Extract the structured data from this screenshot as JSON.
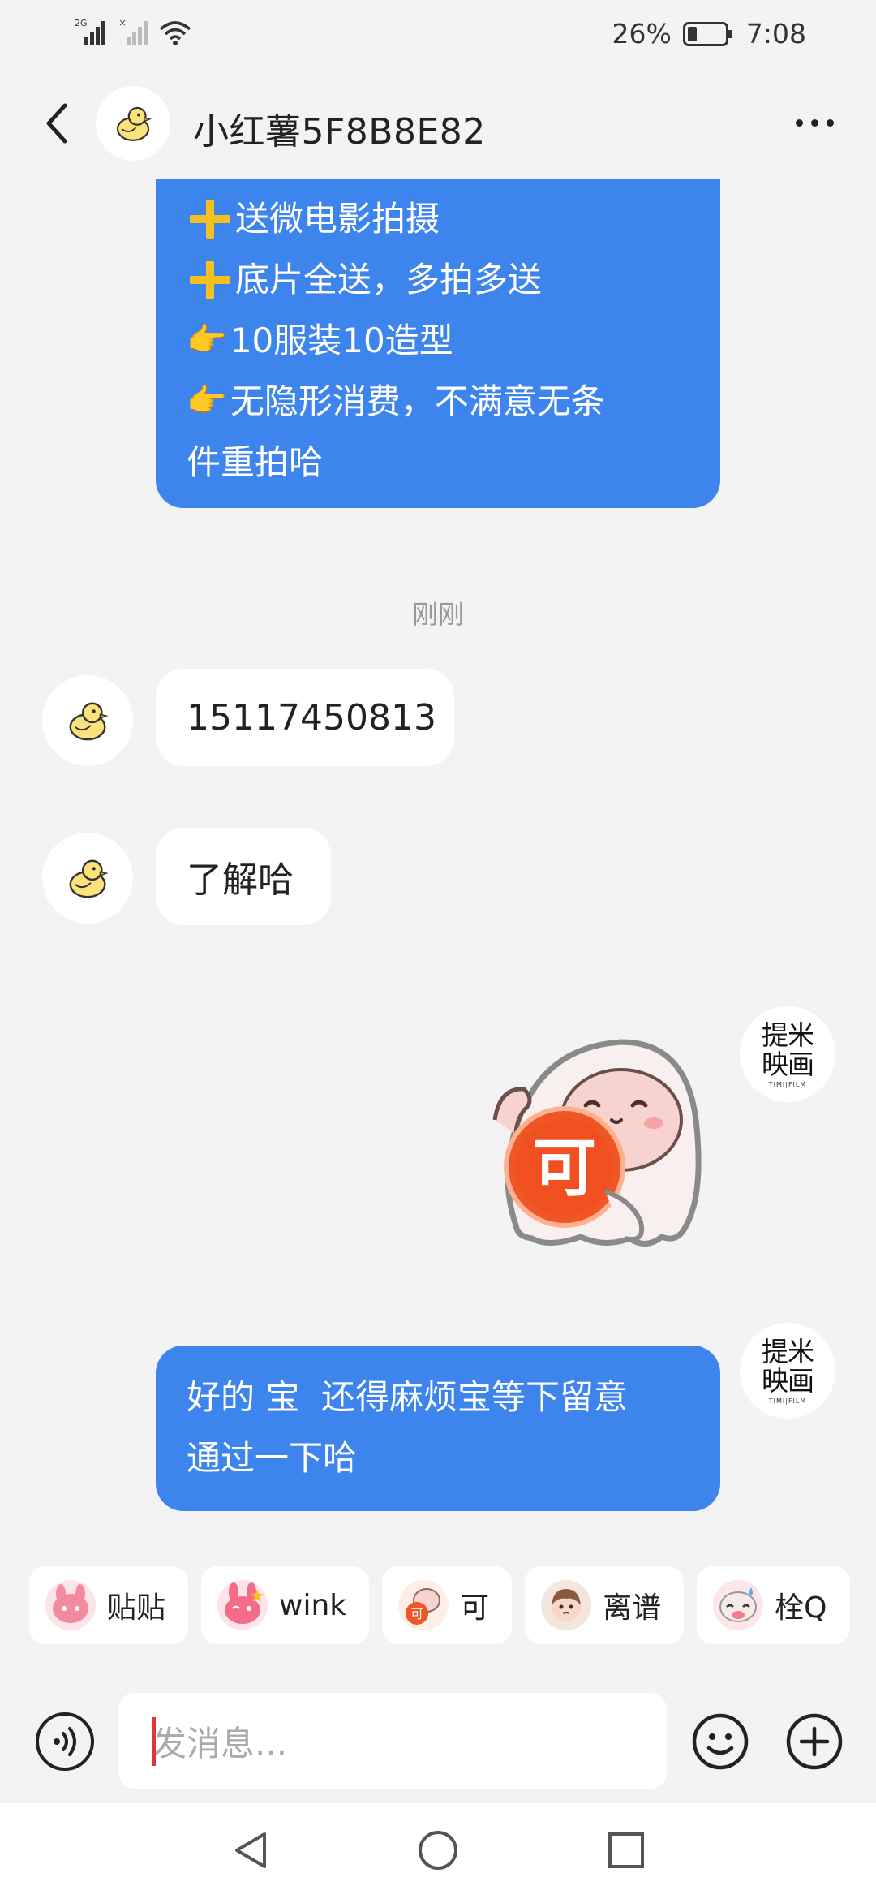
{
  "status_bar": {
    "network_label": "2G",
    "battery": "26%",
    "battery_level": 0.26,
    "time": "7:08"
  },
  "header": {
    "title": "小红薯5F8B8E82",
    "back_icon": "chevron-left-icon",
    "more_icon": "more-horizontal-icon"
  },
  "messages": {
    "top_bubble_lines": [
      "送微电影拍摄",
      "底片全送，多拍多送",
      "10服装10造型",
      "无隐形消费，不满意无条",
      "件重拍哈"
    ],
    "timestamp": "刚刚",
    "phone": "15117450813",
    "reply": "了解哈",
    "sticker_text": "可",
    "last_lines": [
      "好的 宝  还得麻烦宝等下留意",
      "通过一下哈"
    ]
  },
  "avatars": {
    "self_logo_line1": "提米",
    "self_logo_line2": "映画",
    "self_logo_sub": "TIMI|FILM"
  },
  "quick_replies": [
    {
      "label": "贴贴",
      "icon": "pink-bunny-sticker-icon",
      "color": "#f0748a"
    },
    {
      "label": "wink",
      "icon": "wink-bunny-sticker-icon",
      "color": "#f56b8a"
    },
    {
      "label": "可",
      "icon": "ke-sticker-icon",
      "color": "#ef5a2a"
    },
    {
      "label": "离谱",
      "icon": "girl-sticker-icon",
      "color": "#c98a64"
    },
    {
      "label": "栓Q",
      "icon": "thanks-sticker-icon",
      "color": "#f37c8d"
    }
  ],
  "input": {
    "placeholder": "发消息..."
  },
  "colors": {
    "bubble_blue": "#3d85ec",
    "accent_yellow": "#f6c021",
    "caret_red": "#e0343a"
  }
}
